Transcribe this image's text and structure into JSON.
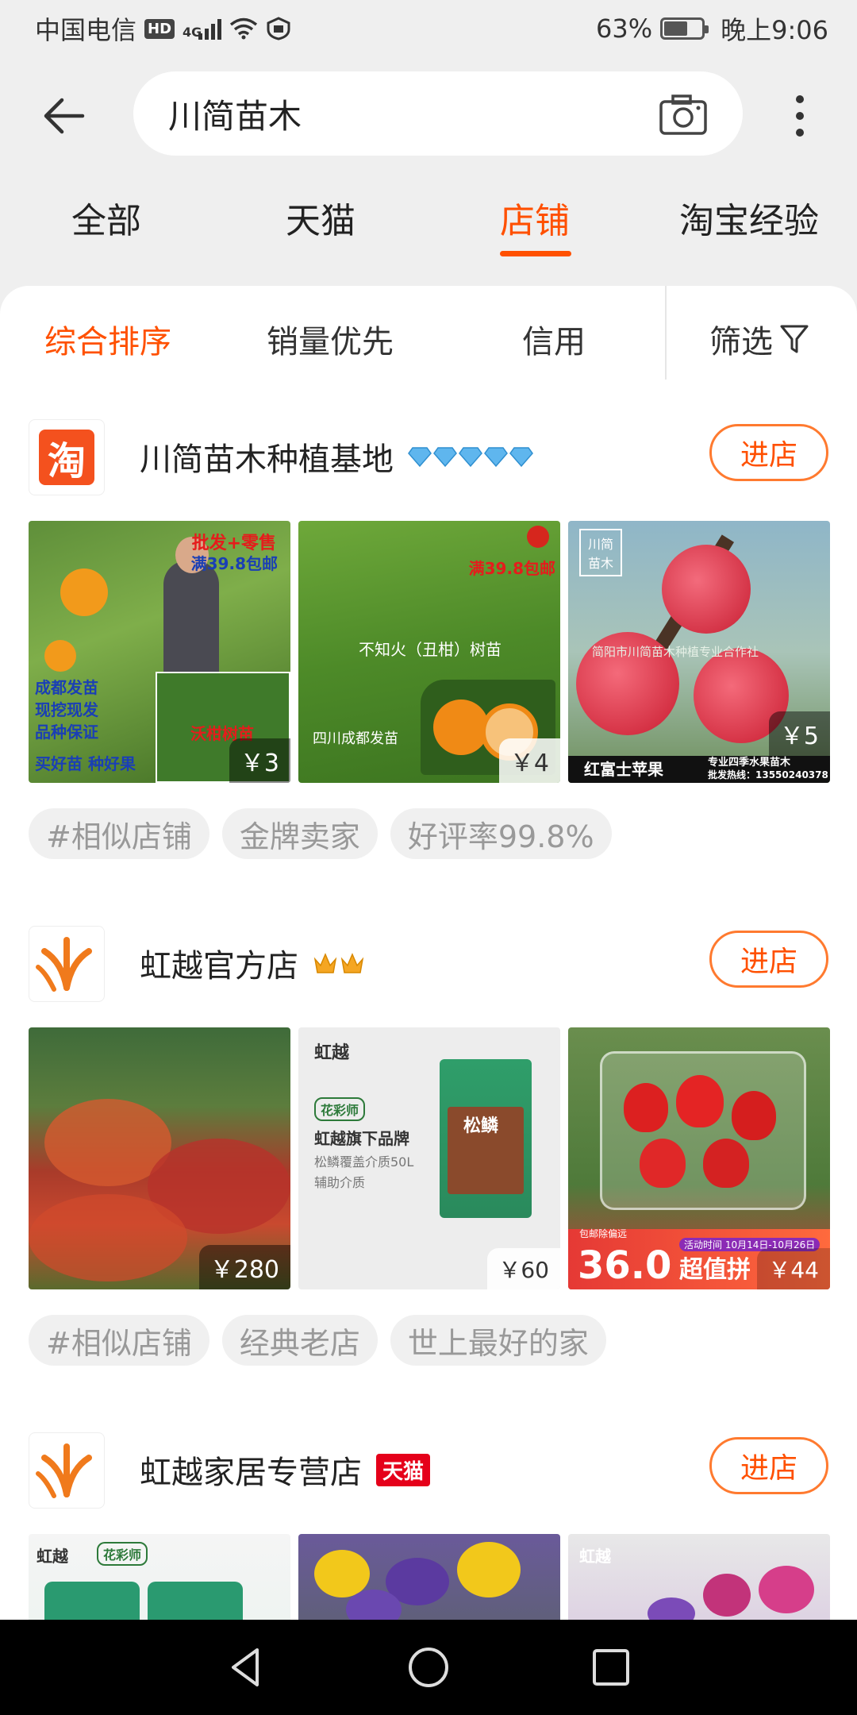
{
  "status": {
    "carrier": "中国电信",
    "hd": "HD",
    "net": "4G",
    "battery_pct_label": "63%",
    "battery_level": 0.63,
    "time": "晚上9:06"
  },
  "search": {
    "query": "川简苗木"
  },
  "top_tabs": [
    {
      "label": "全部"
    },
    {
      "label": "天猫"
    },
    {
      "label": "店铺",
      "active": true
    },
    {
      "label": "淘宝经验"
    }
  ],
  "sort_bar": {
    "items": [
      {
        "label": "综合排序",
        "active": true
      },
      {
        "label": "销量优先"
      },
      {
        "label": "信用"
      }
    ],
    "filter_label": "筛选"
  },
  "shops": [
    {
      "name": "川简苗木种植基地",
      "logo_text": "淘",
      "badge": "diamond-icons",
      "badge_count": 5,
      "enter_label": "进店",
      "products": [
        {
          "price": "￥3",
          "texts": [
            "批发+零售",
            "满39.8包邮",
            "成都发苗",
            "现挖现发",
            "品种保证",
            "买好苗 种好果",
            "沃柑树苗"
          ]
        },
        {
          "price": "￥4",
          "texts": [
            "满39.8包邮",
            "不知火（丑柑）树苗",
            "四川成都发苗"
          ]
        },
        {
          "price": "￥5",
          "texts": [
            "川简",
            "苗木",
            "简阳市川简苗木种植专业合作社",
            "红富士苹果",
            "专业四季水果苗木",
            "批发热线：13550240378"
          ]
        }
      ],
      "tags": [
        "#相似店铺",
        "金牌卖家",
        "好评率99.8%"
      ]
    },
    {
      "name": "虹越官方店",
      "badge": "crown-icons",
      "badge_count": 2,
      "enter_label": "进店",
      "products": [
        {
          "price": "￥280",
          "texts": []
        },
        {
          "price": "￥60",
          "texts": [
            "虹越",
            "花彩师",
            "虹越旗下品牌",
            "松鳞覆盖介质50L",
            "辅助介质",
            "松鳞"
          ]
        },
        {
          "price": "￥44",
          "texts": [
            "包邮除偏远",
            "活动时间  10月14日-10月26日",
            "36.0",
            "超值拼"
          ]
        }
      ],
      "tags": [
        "#相似店铺",
        "经典老店",
        "世上最好的家"
      ]
    },
    {
      "name": "虹越家居专营店",
      "badge_text": "天猫",
      "enter_label": "进店",
      "products": [
        {
          "texts": [
            "虹越",
            "花彩师"
          ]
        },
        {
          "texts": []
        },
        {
          "texts": [
            "虹越"
          ]
        }
      ]
    }
  ],
  "colors": {
    "accent": "#ff5000",
    "tmall_red": "#e5001a",
    "panel_bg": "#ffffff",
    "page_bg": "#efefef"
  }
}
